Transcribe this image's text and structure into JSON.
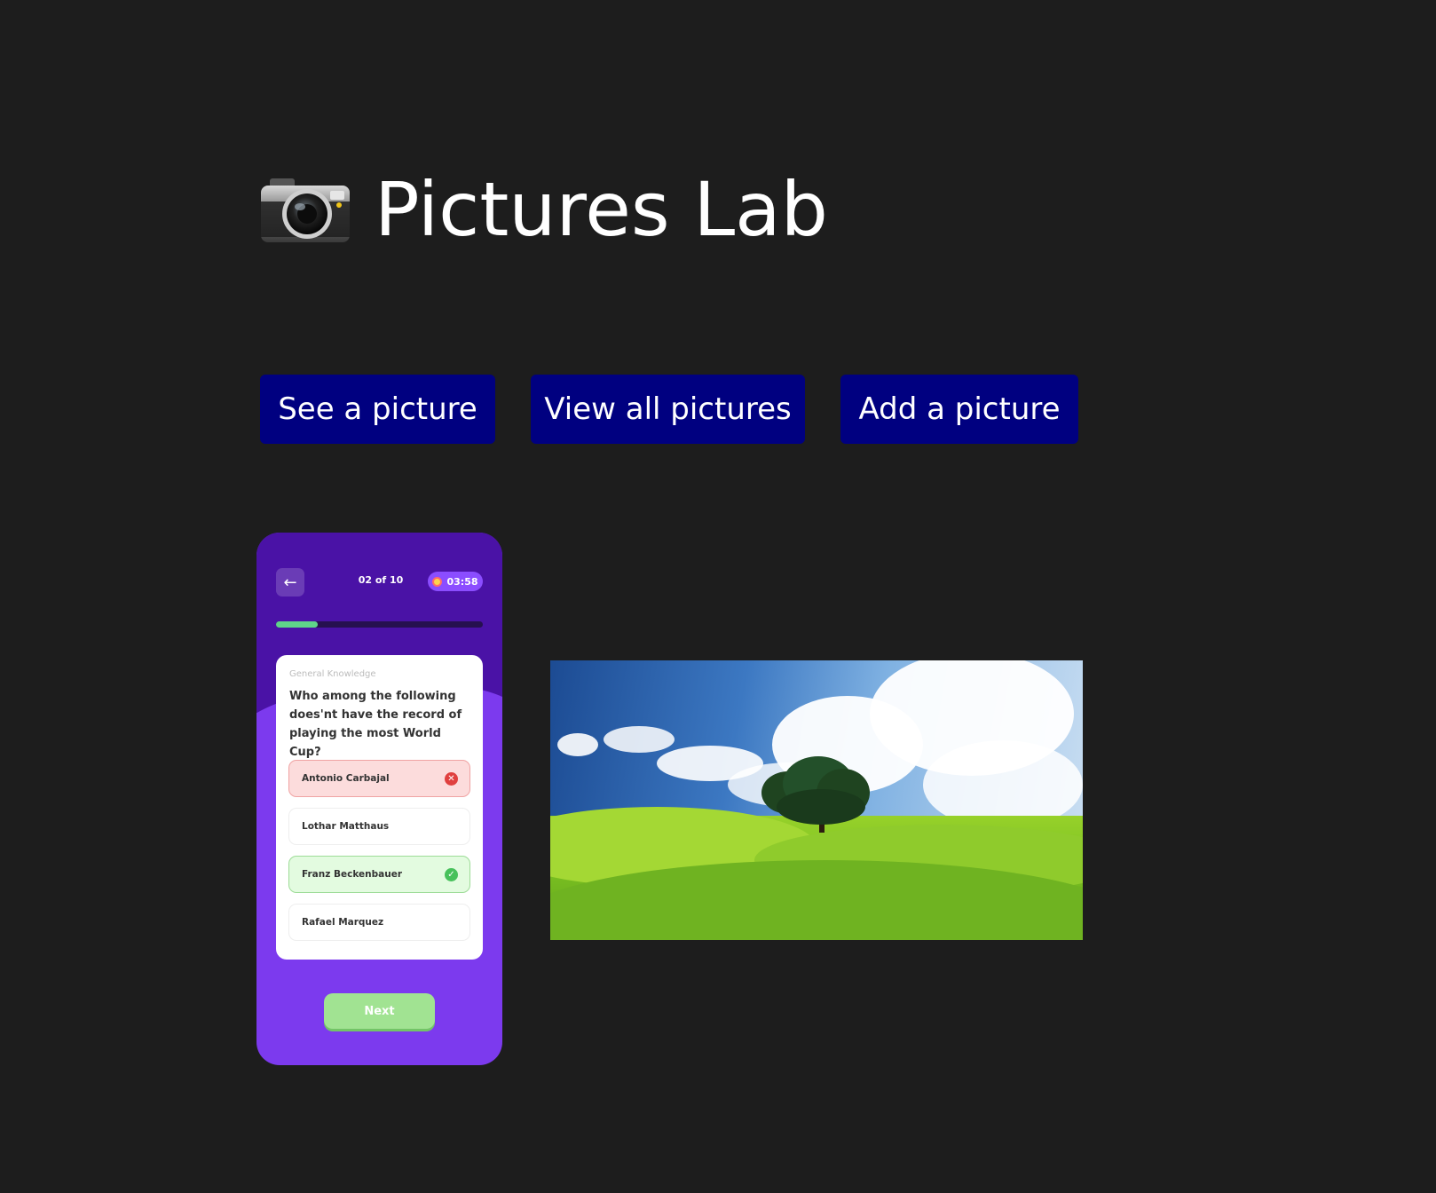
{
  "header": {
    "icon": "camera-icon",
    "title": "Pictures Lab"
  },
  "actions": {
    "see_label": "See a picture",
    "view_all_label": "View all pictures",
    "add_label": "Add a picture"
  },
  "gallery": {
    "quiz_screenshot": {
      "counter": "02 of 10",
      "timer": "03:58",
      "progress": 0.2,
      "category": "General Knowledge",
      "question": "Who among the following does'nt have the record of playing the most World Cup?",
      "options": [
        {
          "label": "Antonio Carbajal",
          "state": "wrong"
        },
        {
          "label": "Lothar Matthaus",
          "state": "neutral"
        },
        {
          "label": "Franz Beckenbauer",
          "state": "correct"
        },
        {
          "label": "Rafael Marquez",
          "state": "neutral"
        }
      ],
      "next_label": "Next"
    },
    "landscape_photo": {
      "subject": "lone-tree-on-green-hills"
    }
  },
  "colors": {
    "background": "#1d1d1d",
    "button": "#000080",
    "quiz_purple": "#7c3aee",
    "quiz_dark": "#4a12a6"
  }
}
